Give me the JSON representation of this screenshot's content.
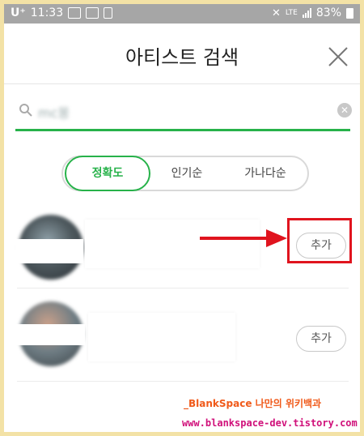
{
  "status_bar": {
    "carrier": "U⁺",
    "time": "11:33",
    "network": "LTE",
    "battery": "83%"
  },
  "header": {
    "title": "아티스트 검색",
    "close_icon": "close-icon"
  },
  "search": {
    "value": "mc몽",
    "accent_color": "#27b24a"
  },
  "sort_tabs": [
    {
      "label": "정확도",
      "active": true
    },
    {
      "label": "인기순",
      "active": false
    },
    {
      "label": "가나다순",
      "active": false
    }
  ],
  "results": [
    {
      "add_label": "추가"
    },
    {
      "add_label": "추가"
    }
  ],
  "watermark": {
    "line1": "_BlankSpace 나만의 위키백과",
    "line2": "www.blankspace-dev.tistory.com"
  },
  "colors": {
    "annotation_red": "#e0141e",
    "frame": "#f3e2a6"
  }
}
